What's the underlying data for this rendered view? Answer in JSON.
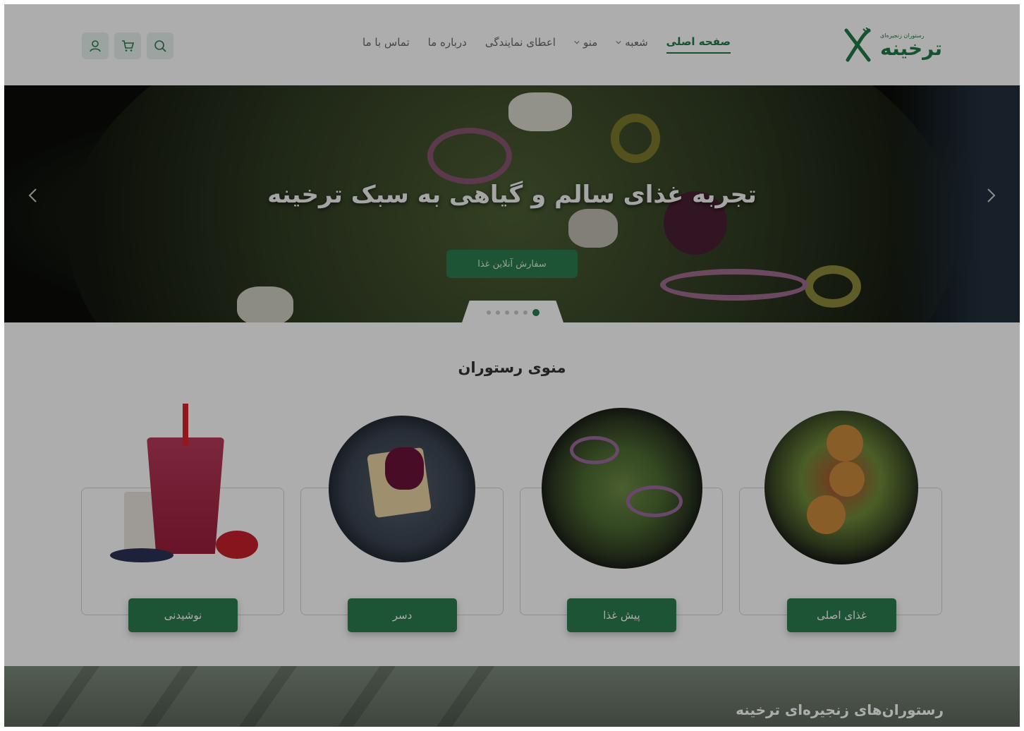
{
  "header": {
    "logo": {
      "name": "ترخینه",
      "tagline": "رستوران زنجیره‌ای"
    },
    "nav": [
      {
        "label": "صفحه اصلی",
        "active": true,
        "dropdown": false
      },
      {
        "label": "شعبه",
        "active": false,
        "dropdown": true
      },
      {
        "label": "منو",
        "active": false,
        "dropdown": true
      },
      {
        "label": "اعطای نمایندگی",
        "active": false,
        "dropdown": false
      },
      {
        "label": "درباره ما",
        "active": false,
        "dropdown": false
      },
      {
        "label": "تماس با ما",
        "active": false,
        "dropdown": false
      }
    ],
    "icons": [
      "search-icon",
      "cart-icon",
      "user-icon"
    ]
  },
  "hero": {
    "title": "تجربه غذای سالم و گیاهی به سبک ترخینه",
    "cta_label": "سفارش آنلاین غذا",
    "slide_count": 6,
    "active_slide": 1
  },
  "menu": {
    "title": "منوی رستوران",
    "categories": [
      {
        "label": "غذای اصلی"
      },
      {
        "label": "پیش غذا"
      },
      {
        "label": "دسر"
      },
      {
        "label": "نوشیدنی"
      }
    ]
  },
  "branches": {
    "title": "رستوران‌های زنجیره‌ای ترخینه"
  },
  "colors": {
    "brand_green": "#2a7c4f",
    "dark_overlay": "rgba(0,0,0,0.32)"
  }
}
